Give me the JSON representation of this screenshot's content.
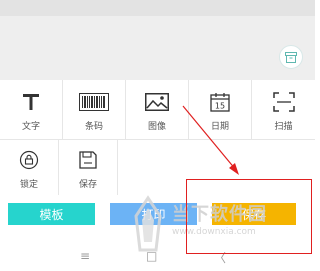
{
  "tools_row1": [
    {
      "label": "文字",
      "icon": "text-T-icon"
    },
    {
      "label": "条码",
      "icon": "barcode-icon"
    },
    {
      "label": "图像",
      "icon": "image-icon"
    },
    {
      "label": "日期",
      "icon": "calendar-icon",
      "icon_text": "15"
    },
    {
      "label": "扫描",
      "icon": "scan-icon"
    }
  ],
  "tools_row2": [
    {
      "label": "锁定",
      "icon": "lock-icon"
    },
    {
      "label": "保存",
      "icon": "floppy-save-icon"
    }
  ],
  "buttons": {
    "template": "模板",
    "print": "打印",
    "save": "保存"
  },
  "nav": {
    "menu": "≡",
    "home": "□",
    "back": "〈"
  },
  "watermark": {
    "text": "当下软件园",
    "url": "www.downxia.com"
  },
  "colors": {
    "template_btn": "#26d4cd",
    "print_btn": "#6cb3f5",
    "save_btn": "#f5b400",
    "highlight": "#e02020"
  }
}
